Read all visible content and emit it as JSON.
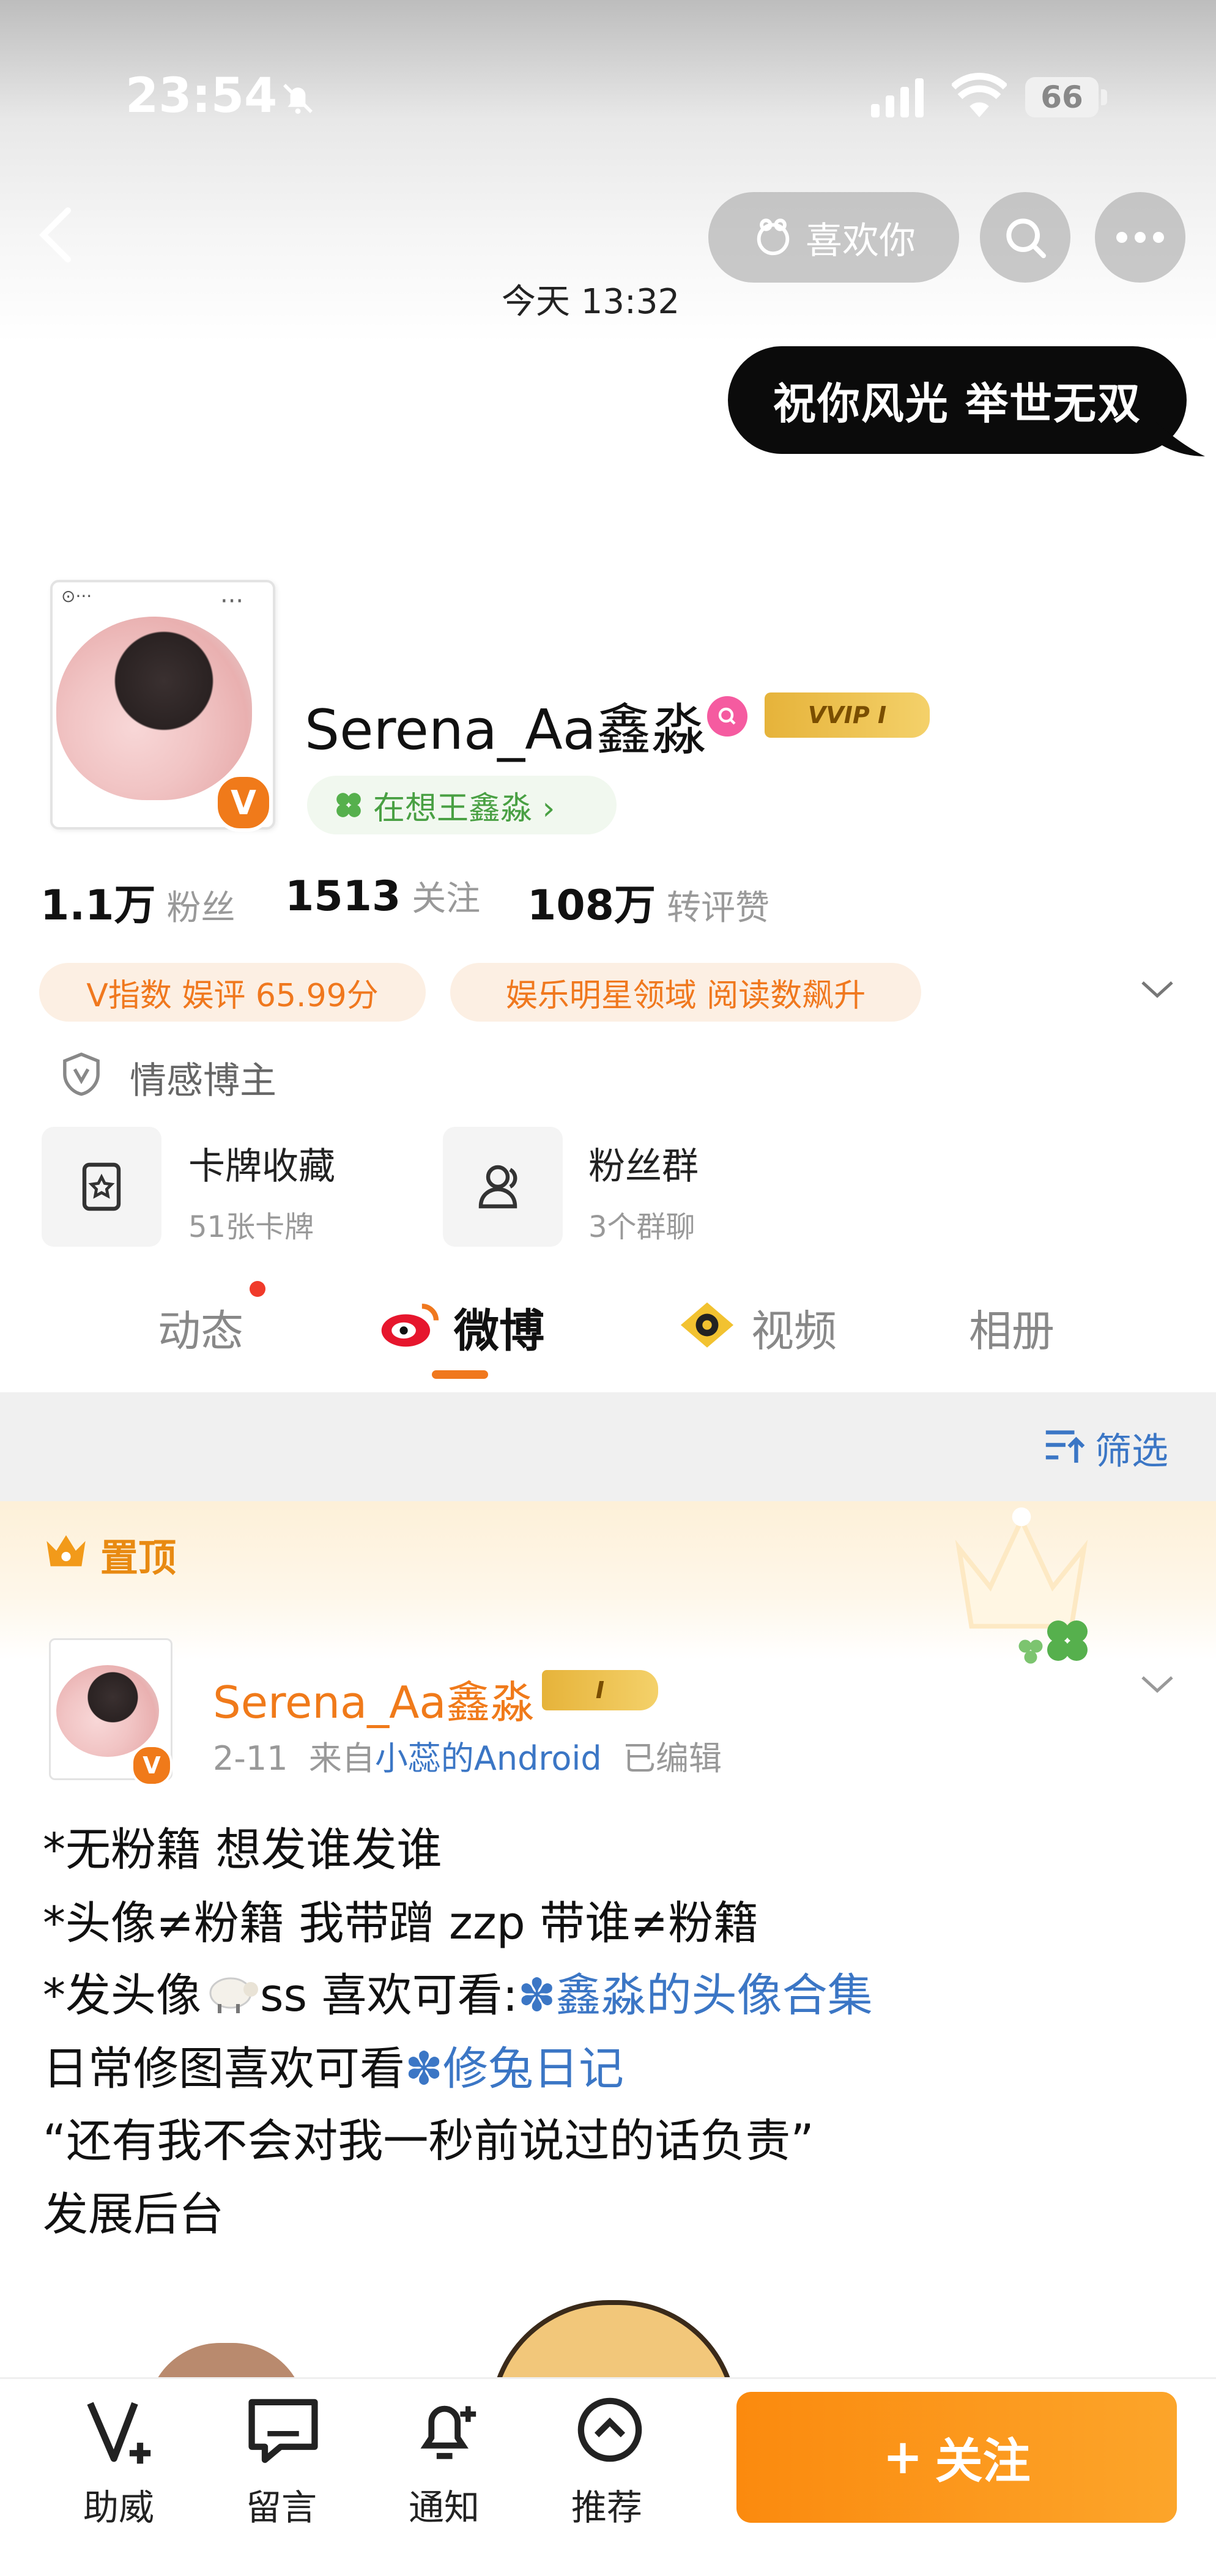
{
  "status_bar": {
    "time": "23:54",
    "battery": "66"
  },
  "nav": {
    "like_label": "喜欢你"
  },
  "chat": {
    "timestamp": "今天 13:32",
    "message": "祝你风光  举世无双"
  },
  "profile": {
    "name": "Serena_Aa鑫淼",
    "vip_badge": "VVIP I",
    "thinking_tag": "在想王鑫淼 ›",
    "stats": [
      {
        "num": "1.1万",
        "label": "粉丝"
      },
      {
        "num": "1513",
        "label": "关注"
      },
      {
        "num": "108万",
        "label": "转评赞"
      }
    ],
    "pills": [
      "V指数 娱评 65.99分",
      "娱乐明星领域 阅读数飙升"
    ],
    "verified_label": "情感博主",
    "cards": [
      {
        "title": "卡牌收藏",
        "subtitle": "51张卡牌"
      },
      {
        "title": "粉丝群",
        "subtitle": "3个群聊"
      }
    ]
  },
  "tabs": [
    {
      "label": "动态"
    },
    {
      "label": "微博"
    },
    {
      "label": "视频"
    },
    {
      "label": "相册"
    }
  ],
  "filter": {
    "label": "筛选"
  },
  "pinned": {
    "label": "置顶"
  },
  "post": {
    "author": "Serena_Aa鑫淼",
    "badge": "I",
    "date": "2-11",
    "source_prefix": "来自",
    "source": "小蕊的Android",
    "edited": "已编辑",
    "lines": {
      "l1": "*无粉籍 想发谁发谁",
      "l2": "*头像≠粉籍 我带蹭 zzp 带谁≠粉籍",
      "l3a": "*发头像",
      "l3b": "ss 喜欢可看:",
      "l3link": "鑫淼的头像合集",
      "l4a": "日常修图喜欢可看",
      "l4link": "修兔日记",
      "l5": "“还有我不会对我一秒前说过的话负责”",
      "l6": "发展后台"
    }
  },
  "bottom_nav": [
    {
      "label": "助威"
    },
    {
      "label": "留言"
    },
    {
      "label": "通知"
    },
    {
      "label": "推荐"
    }
  ],
  "follow_button": "关注",
  "colors": {
    "accent": "#f0781e",
    "link": "#3b76c5",
    "green": "#49a043"
  }
}
